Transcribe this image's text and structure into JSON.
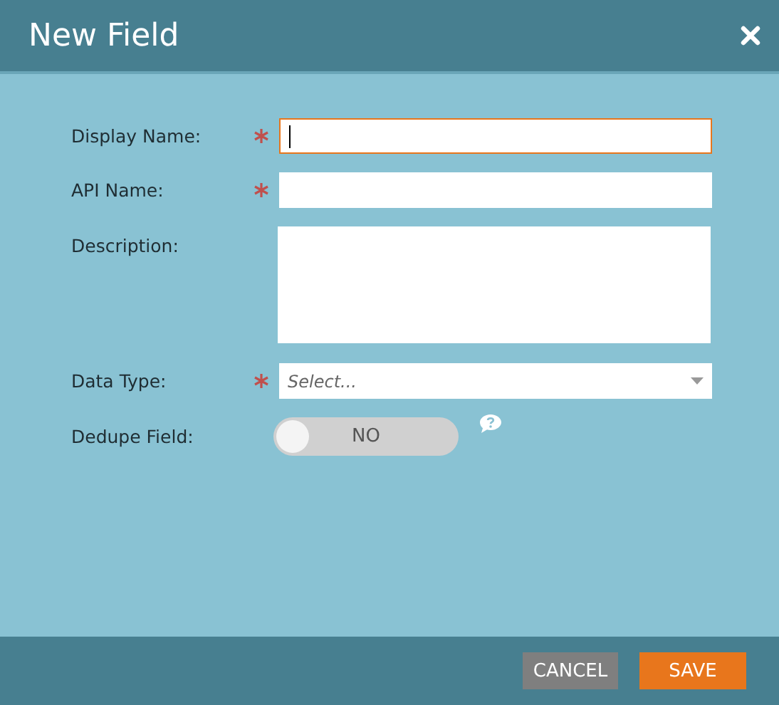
{
  "window": {
    "title": "New Field"
  },
  "fields": [
    {
      "kind": "text",
      "label": "Display Name:",
      "required": true,
      "focused": true
    },
    {
      "kind": "text",
      "label": "API Name:",
      "required": true,
      "focused": false
    },
    {
      "kind": "textarea",
      "label": "Description:",
      "required": false,
      "focused": false
    },
    {
      "kind": "select",
      "label": "Data Type:",
      "required": true,
      "focused": false,
      "placeholder": "Select..."
    },
    {
      "kind": "toggle",
      "label": "Dedupe Field:",
      "required": false,
      "on": false,
      "state_label": "NO",
      "help": true
    }
  ],
  "buttons": [
    {
      "label": "CANCEL",
      "kind": "secondary"
    },
    {
      "label": "SAVE",
      "kind": "primary"
    }
  ]
}
